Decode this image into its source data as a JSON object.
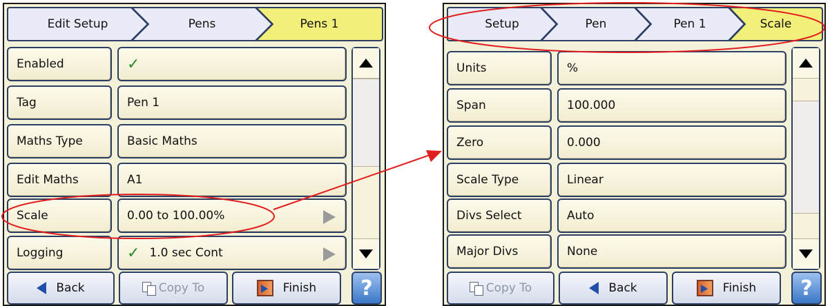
{
  "left_screen": {
    "breadcrumb": [
      "Edit Setup",
      "Pens",
      "Pens 1"
    ],
    "rows": [
      {
        "label": "Enabled",
        "value": "",
        "check": "✓",
        "submenu": false
      },
      {
        "label": "Tag",
        "value": "Pen 1",
        "check": "",
        "submenu": false
      },
      {
        "label": "Maths Type",
        "value": "Basic Maths",
        "check": "",
        "submenu": false
      },
      {
        "label": "Edit Maths",
        "value": "A1",
        "check": "",
        "submenu": false
      },
      {
        "label": "Scale",
        "value": "0.00 to 100.00%",
        "check": "",
        "submenu": true
      },
      {
        "label": "Logging",
        "value": "1.0 sec Cont",
        "check": "✓",
        "submenu": true
      }
    ],
    "buttons": {
      "back": "Back",
      "copy_to": "Copy To",
      "finish": "Finish",
      "help": "?"
    }
  },
  "right_screen": {
    "breadcrumb": [
      "Setup",
      "Pen",
      "Pen 1",
      "Scale"
    ],
    "rows": [
      {
        "label": "Units",
        "value": "%"
      },
      {
        "label": "Span",
        "value": "100.000"
      },
      {
        "label": "Zero",
        "value": "0.000"
      },
      {
        "label": "Scale Type",
        "value": "Linear"
      },
      {
        "label": "Divs Select",
        "value": "Auto"
      },
      {
        "label": "Major Divs",
        "value": "None"
      }
    ],
    "buttons": {
      "copy_to": "Copy To",
      "back": "Back",
      "finish": "Finish",
      "help": "?"
    }
  },
  "colors": {
    "active_crumb": "#f2f07a",
    "crumb": "#e9ecf8",
    "row_background": "#f6f2d9",
    "annotation": "#e11d1d",
    "check": "#2a8a2a"
  },
  "icons": [
    "check-icon",
    "chevron-right-icon",
    "scroll-up-icon",
    "scroll-down-icon",
    "back-arrow-icon",
    "copy-icon",
    "finish-icon",
    "help-icon"
  ]
}
